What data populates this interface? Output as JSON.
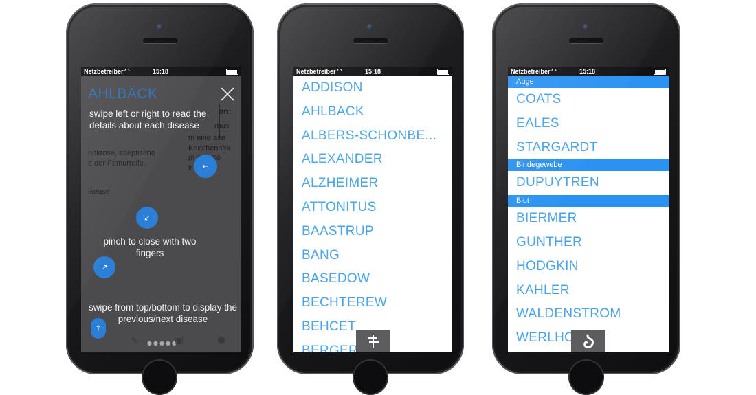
{
  "status_bar": {
    "carrier": "Netzbetreiber",
    "time": "15:18"
  },
  "phone1": {
    "title": "AHLBÄCK",
    "close_icon": "close-icon",
    "background_text": [
      "rbus",
      "m eine ase",
      "Knochennek",
      "m den Ko",
      "k",
      "nekrose, aseptische",
      "e der Femurrolle.",
      "isease"
    ],
    "background_heading": "on:",
    "tips": {
      "swipe_lr": "swipe left or right to read the details about each disease",
      "pinch": "pinch to close with two fingers",
      "swipe_tb": "swipe from top/bottom to display the previous/next disease"
    },
    "colors": {
      "accent": "#2c7fd6",
      "overlay": "#4b4b4d"
    }
  },
  "phone2": {
    "items": [
      "ADDISON",
      "AHLBACK",
      "ALBERS-SCHONBE...",
      "ALEXANDER",
      "ALZHEIMER",
      "ATTONITUS",
      "BAASTRUP",
      "BANG",
      "BASEDOW",
      "BECHTEREW",
      "BEHCET",
      "BERGER"
    ],
    "float_button_icon": "signpost-icon"
  },
  "phone3": {
    "sections": [
      {
        "label": "Auge",
        "items": [
          "COATS",
          "EALES",
          "STARGARDT"
        ]
      },
      {
        "label": "Bindegewebe",
        "items": [
          "DUPUYTREN"
        ]
      },
      {
        "label": "Blut",
        "items": [
          "BIERMER",
          "GUNTHER",
          "HODGKIN",
          "KAHLER",
          "WALDENSTROM",
          "WERLHOF"
        ]
      }
    ],
    "float_button_icon": "stomach-icon"
  },
  "colors": {
    "list_text": "#4aa3e8",
    "section_bg": "#2a92f2"
  }
}
